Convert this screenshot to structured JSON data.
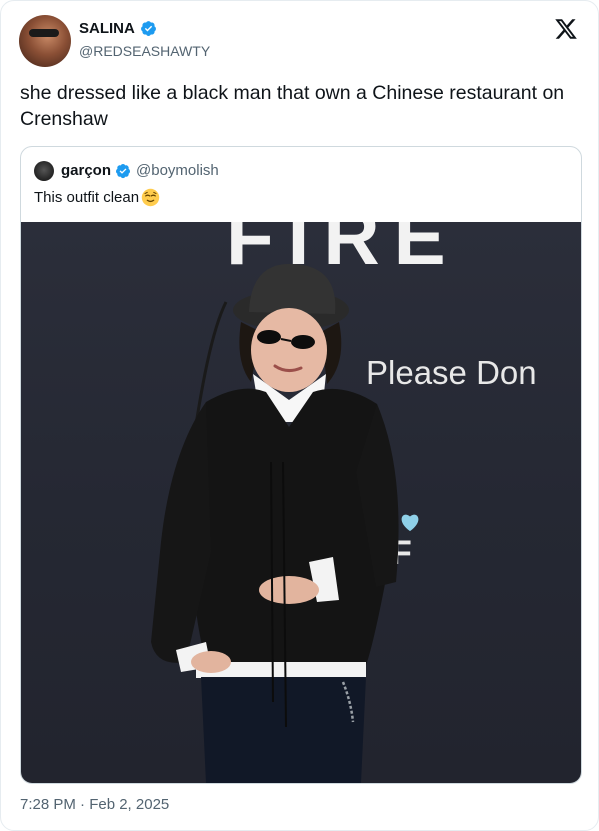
{
  "author": {
    "display_name": "SALINA",
    "handle": "@REDSEASHAWTY",
    "verified": true
  },
  "tweet": {
    "text": "she dressed like a black man that own a Chinese restaurant on Crenshaw",
    "timestamp": "7:28 PM · Feb 2, 2025"
  },
  "quoted_tweet": {
    "display_name": "garçon",
    "handle": "@boymolish",
    "verified": true,
    "text": "This outfit clean",
    "emoji": "relieved-face"
  },
  "media": {
    "backdrop_text_top": "FIRE",
    "backdrop_text_middle": "Please Don",
    "backdrop_text_logo": "F"
  },
  "colors": {
    "verified_blue": "#1d9bf0",
    "secondary_text": "#536471",
    "border": "#cfd9de"
  },
  "icons": {
    "platform_logo": "x-logo-icon",
    "verified": "verified-badge-icon"
  }
}
